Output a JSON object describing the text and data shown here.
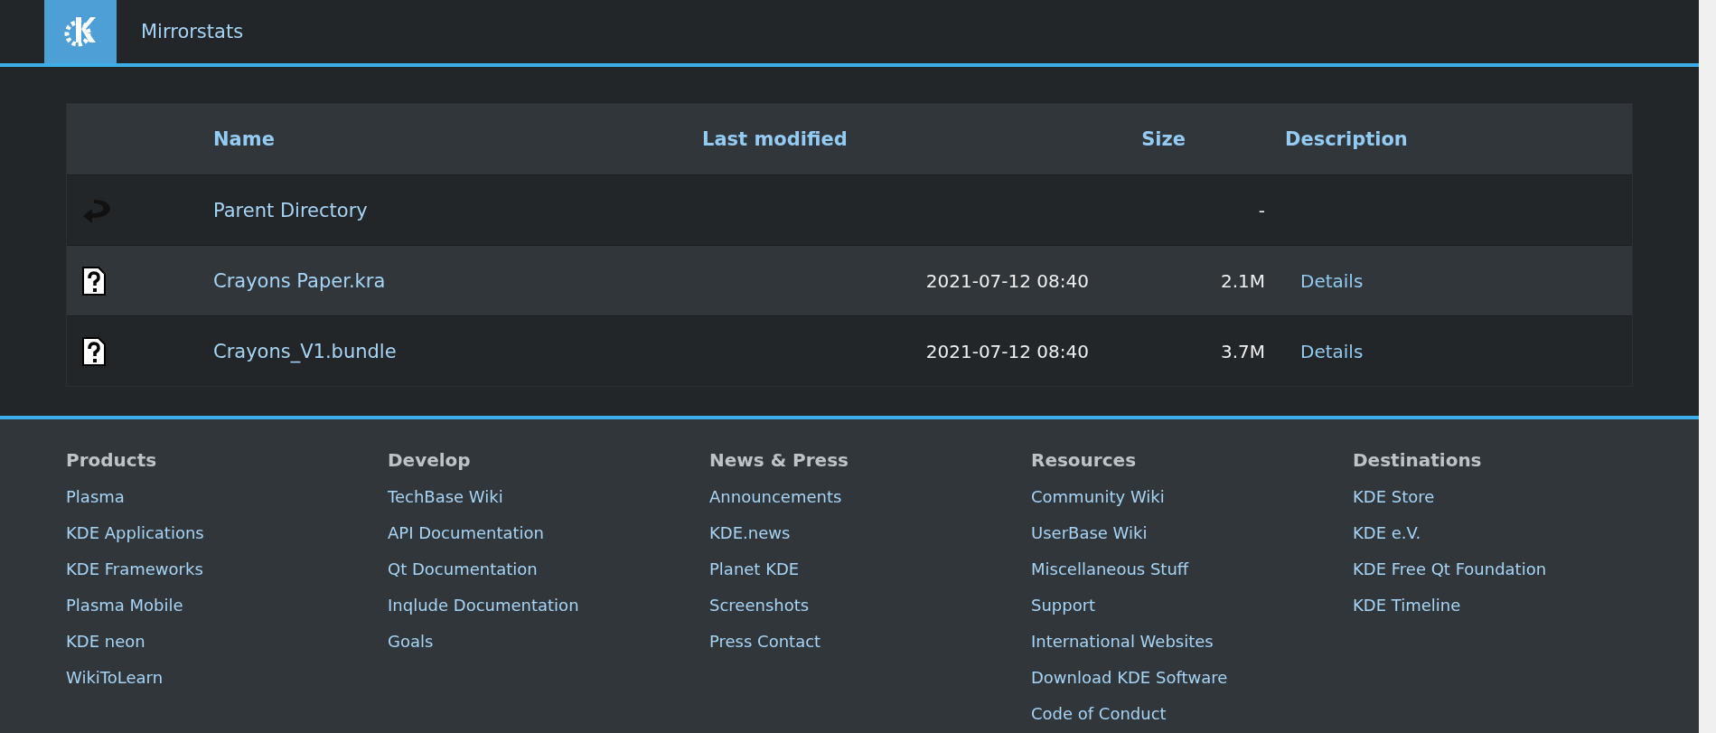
{
  "header": {
    "title": "Mirrorstats"
  },
  "table": {
    "columns": [
      "Name",
      "Last modified",
      "Size",
      "Description"
    ],
    "rows": [
      {
        "kind": "parent",
        "name": "Parent Directory",
        "modified": "",
        "size": "-",
        "description": ""
      },
      {
        "kind": "file",
        "name": "Crayons Paper.kra",
        "modified": "2021-07-12 08:40",
        "size": "2.1M",
        "description": "Details"
      },
      {
        "kind": "file",
        "name": "Crayons_V1.bundle",
        "modified": "2021-07-12 08:40",
        "size": "3.7M",
        "description": "Details"
      }
    ]
  },
  "footer": {
    "columns": [
      {
        "heading": "Products",
        "links": [
          "Plasma",
          "KDE Applications",
          "KDE Frameworks",
          "Plasma Mobile",
          "KDE neon",
          "WikiToLearn"
        ]
      },
      {
        "heading": "Develop",
        "links": [
          "TechBase Wiki",
          "API Documentation",
          "Qt Documentation",
          "Inqlude Documentation",
          "Goals"
        ]
      },
      {
        "heading": "News & Press",
        "links": [
          "Announcements",
          "KDE.news",
          "Planet KDE",
          "Screenshots",
          "Press Contact"
        ]
      },
      {
        "heading": "Resources",
        "links": [
          "Community Wiki",
          "UserBase Wiki",
          "Miscellaneous Stuff",
          "Support",
          "International Websites",
          "Download KDE Software",
          "Code of Conduct"
        ]
      },
      {
        "heading": "Destinations",
        "links": [
          "KDE Store",
          "KDE e.V.",
          "KDE Free Qt Foundation",
          "KDE Timeline"
        ]
      }
    ]
  }
}
